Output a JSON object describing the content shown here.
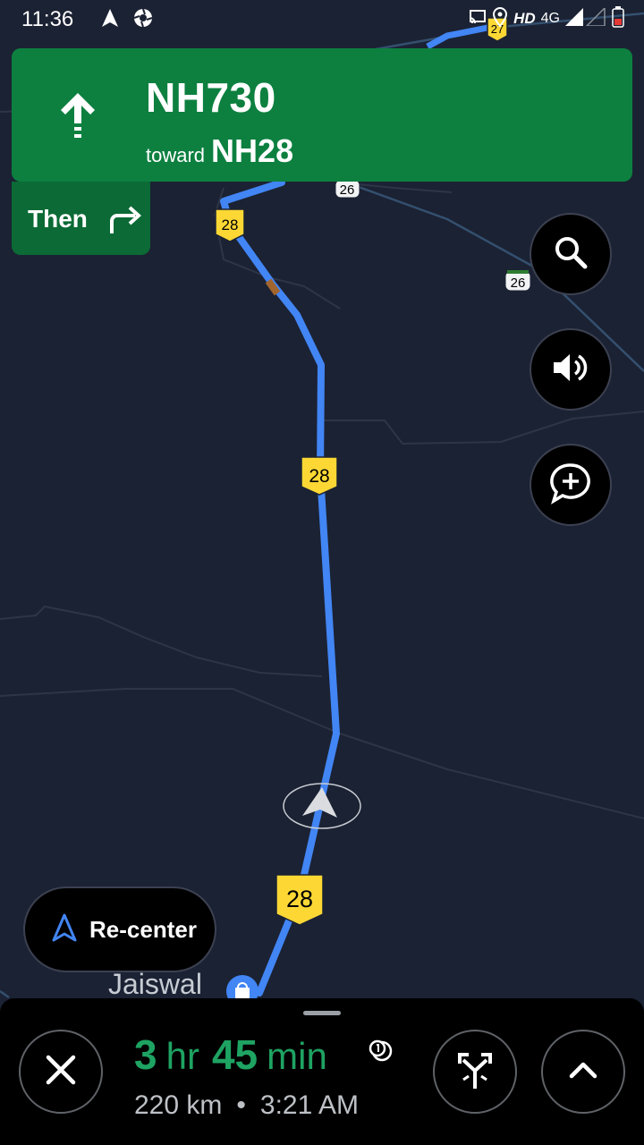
{
  "status_bar": {
    "time": "11:36",
    "hd_label": "HD",
    "network_label": "4G",
    "icons": [
      "navigation-icon",
      "camera-aperture-icon",
      "cast-icon",
      "location-pin-icon",
      "signal-icon",
      "battery-icon"
    ]
  },
  "map": {
    "route_shields": [
      "27",
      "28",
      "26",
      "26",
      "28",
      "28"
    ],
    "route_color": "#4285f4",
    "shield_color": "#fdd835",
    "poi_label": "Jaiswal"
  },
  "nav_banner": {
    "road": "NH730",
    "toward_label": "toward",
    "toward_road": "NH28",
    "maneuver_icon": "straight-arrow-icon",
    "color": "#0d8040"
  },
  "then_card": {
    "label": "Then",
    "icon": "turn-right-icon"
  },
  "map_controls": [
    "search-icon",
    "volume-icon",
    "add-report-icon"
  ],
  "recenter": {
    "label": "Re-center",
    "icon": "navigation-arrow-icon"
  },
  "trip": {
    "hours": "3",
    "hours_unit": "hr",
    "minutes": "45",
    "minutes_unit": "min",
    "distance": "220 km",
    "separator": "•",
    "arrival": "3:21 AM",
    "eta_color": "#1ea362",
    "badge_icon": "toll-alert-icon"
  }
}
